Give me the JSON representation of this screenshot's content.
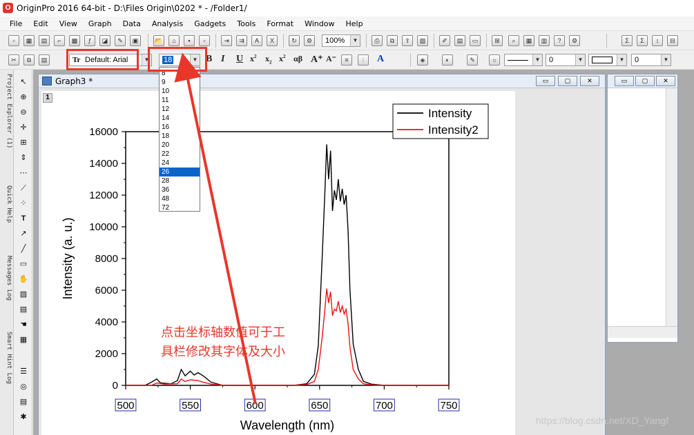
{
  "app": {
    "title": "OriginPro 2016 64-bit - D:\\Files Origin\\0202 * - /Folder1/"
  },
  "menu": [
    "File",
    "Edit",
    "View",
    "Graph",
    "Data",
    "Analysis",
    "Gadgets",
    "Tools",
    "Format",
    "Window",
    "Help"
  ],
  "toolbar": {
    "zoom": "100%",
    "font_combo": "Default: Arial",
    "size_combo": "18",
    "subscript_label": "x",
    "greek_label": "αβ",
    "line_width_value": "0",
    "line_width_value2": "0"
  },
  "size_dropdown": {
    "options": [
      "8",
      "9",
      "10",
      "11",
      "12",
      "14",
      "16",
      "18",
      "20",
      "22",
      "24",
      "26",
      "28",
      "36",
      "48",
      "72"
    ],
    "highlighted": "26"
  },
  "side_tabs": [
    "Project Explorer (1)",
    "Quick Help",
    "Messages Log",
    "Smart Hint Log"
  ],
  "graph_window": {
    "title": "Graph3 *",
    "layer_number": "1"
  },
  "annotation": {
    "line1": "点击坐标轴数值可于工",
    "line2": "具栏修改其字体及大小"
  },
  "watermark": "https://blog.csdn.net/XD_Yangf",
  "colors": {
    "highlight": "#e8372a",
    "intensity": "#000000",
    "intensity2": "#ee1111",
    "selection": "#0a64c8"
  },
  "chart_data": {
    "type": "line",
    "xlabel": "Wavelength (nm)",
    "ylabel": "Intensity (a. u.)",
    "xlim": [
      500,
      750
    ],
    "ylim": [
      0,
      16000
    ],
    "xticks": [
      "500",
      "550",
      "600",
      "650",
      "700",
      "750"
    ],
    "yticks": [
      "0",
      "2000",
      "4000",
      "6000",
      "8000",
      "10000",
      "12000",
      "14000",
      "16000"
    ],
    "legend_position": "top-right",
    "series": [
      {
        "name": "Intensity",
        "color": "#000000",
        "x": [
          500,
          515,
          520,
          524,
          527,
          535,
          540,
          543,
          546,
          550,
          553,
          556,
          560,
          566,
          575,
          600,
          630,
          640,
          646,
          649,
          652,
          654,
          655.5,
          657,
          658.5,
          660,
          661.5,
          663,
          664.5,
          666,
          667.5,
          669,
          670.5,
          672,
          673.5,
          676,
          680,
          684,
          690,
          700,
          750
        ],
        "y": [
          0,
          0,
          200,
          400,
          150,
          100,
          300,
          1000,
          600,
          900,
          650,
          800,
          600,
          200,
          0,
          0,
          0,
          100,
          700,
          2500,
          8000,
          12000,
          15200,
          13000,
          14800,
          11000,
          12300,
          11700,
          13000,
          11600,
          12400,
          11400,
          12000,
          9800,
          6000,
          2600,
          1000,
          250,
          80,
          0,
          0
        ]
      },
      {
        "name": "Intensity2",
        "color": "#ee1111",
        "x": [
          500,
          520,
          524,
          530,
          540,
          543,
          546,
          550,
          556,
          560,
          566,
          575,
          600,
          630,
          640,
          646,
          649,
          652,
          654,
          655.5,
          657,
          658.5,
          660,
          661.5,
          663,
          664.5,
          666,
          667.5,
          669,
          670.5,
          672,
          673.5,
          676,
          680,
          684,
          690,
          700,
          750
        ],
        "y": [
          0,
          0,
          150,
          80,
          100,
          400,
          250,
          350,
          300,
          200,
          80,
          0,
          0,
          0,
          50,
          250,
          1000,
          3000,
          4700,
          6100,
          5200,
          5900,
          4400,
          4800,
          4700,
          5300,
          4600,
          5000,
          4500,
          4800,
          3900,
          2400,
          1000,
          400,
          100,
          30,
          0,
          0
        ]
      }
    ]
  }
}
